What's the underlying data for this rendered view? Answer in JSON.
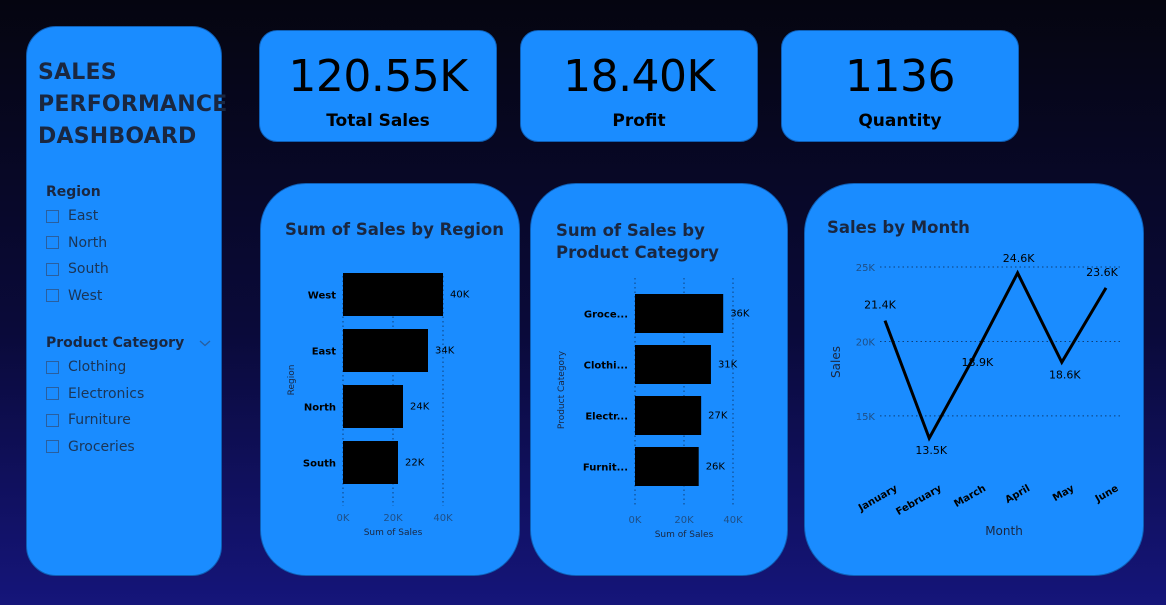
{
  "dashboard": {
    "title_lines": [
      "SALES",
      "PERFORMANCE",
      "DASHBOARD"
    ]
  },
  "filters": {
    "region": {
      "label": "Region",
      "items": [
        "East",
        "North",
        "South",
        "West"
      ]
    },
    "product_category": {
      "label": "Product Category",
      "items": [
        "Clothing",
        "Electronics",
        "Furniture",
        "Groceries"
      ]
    }
  },
  "kpis": [
    {
      "value": "120.55K",
      "label": "Total Sales"
    },
    {
      "value": "18.40K",
      "label": "Profit"
    },
    {
      "value": "1136",
      "label": "Quantity"
    }
  ],
  "colors": {
    "card": "#1a8cff",
    "bar": "#000000",
    "line": "#000000",
    "text_dark": "#1a2740"
  },
  "chart_data": [
    {
      "type": "bar",
      "orientation": "horizontal",
      "title": "Sum of Sales by Region",
      "xlabel": "Sum of Sales",
      "ylabel": "Region",
      "categories": [
        "West",
        "East",
        "North",
        "South"
      ],
      "values": [
        40,
        34,
        24,
        22
      ],
      "data_labels": [
        "40K",
        "34K",
        "24K",
        "22K"
      ],
      "xlim": [
        0,
        40
      ],
      "xticks": [
        "0K",
        "20K",
        "40K"
      ],
      "grid": "vertical dotted"
    },
    {
      "type": "bar",
      "orientation": "horizontal",
      "title": "Sum of Sales by Product Category",
      "xlabel": "Sum of Sales",
      "ylabel": "Product Category",
      "categories": [
        "Groce...",
        "Clothi...",
        "Electr...",
        "Furnit..."
      ],
      "values": [
        36,
        31,
        27,
        26
      ],
      "data_labels": [
        "36K",
        "31K",
        "27K",
        "26K"
      ],
      "xlim": [
        0,
        40
      ],
      "xticks": [
        "0K",
        "20K",
        "40K"
      ],
      "grid": "vertical dotted"
    },
    {
      "type": "line",
      "title": "Sales by Month",
      "xlabel": "Month",
      "ylabel": "Sales",
      "categories": [
        "January",
        "February",
        "March",
        "April",
        "May",
        "June"
      ],
      "values": [
        21.4,
        13.5,
        18.9,
        24.6,
        18.6,
        23.6
      ],
      "data_labels": [
        "21.4K",
        "13.5K",
        "18.9K",
        "24.6K",
        "18.6K",
        "23.6K"
      ],
      "ylim": [
        11.5,
        25
      ],
      "yticks": [
        "15K",
        "20K",
        "25K"
      ],
      "grid": "horizontal dotted"
    }
  ]
}
